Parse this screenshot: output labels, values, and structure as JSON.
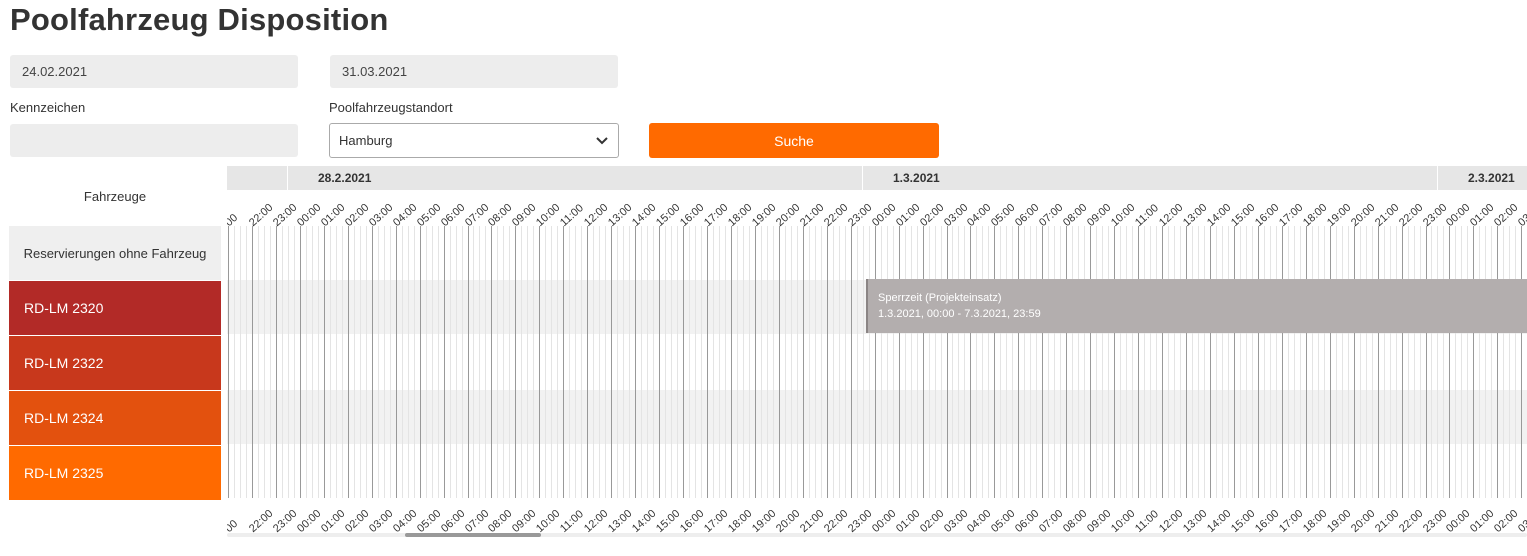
{
  "page": {
    "title": "Poolfahrzeug Disposition"
  },
  "filters": {
    "date_from": "24.02.2021",
    "date_to": "31.03.2021",
    "plate_label": "Kennzeichen",
    "plate_value": "",
    "location_label": "Poolfahrzeugstandort",
    "location_value": "Hamburg",
    "search_label": "Suche"
  },
  "scheduler": {
    "vehicles_header": "Fahrzeuge",
    "unassigned_label": "Reservierungen ohne Fahrzeug",
    "vehicles": [
      {
        "plate": "RD-LM 2320",
        "color": "#b22a27"
      },
      {
        "plate": "RD-LM 2322",
        "color": "#c8381c"
      },
      {
        "plate": "RD-LM 2324",
        "color": "#e3510e"
      },
      {
        "plate": "RD-LM 2325",
        "color": "#ff6a00"
      }
    ],
    "days": [
      "28.2.2021",
      "1.3.2021",
      "2.3.2021"
    ],
    "hours_visible": [
      "00",
      "22:00",
      "23:00",
      "00:00",
      "01:00",
      "02:00",
      "03:00",
      "04:00",
      "05:00",
      "06:00",
      "07:00",
      "08:00",
      "09:00",
      "10:00",
      "11:00",
      "12:00",
      "13:00",
      "14:00",
      "15:00",
      "16:00",
      "17:00",
      "18:00",
      "19:00",
      "20:00",
      "21:00",
      "22:00",
      "23:00",
      "00:00",
      "01:00",
      "02:00",
      "03:00",
      "04:00",
      "05:00",
      "06:00",
      "07:00",
      "08:00",
      "09:00",
      "10:00",
      "11:00",
      "12:00",
      "13:00",
      "14:00",
      "15:00",
      "16:00",
      "17:00",
      "18:00",
      "19:00",
      "20:00",
      "21:00",
      "22:00",
      "23:00",
      "00:00",
      "01:00",
      "02:00",
      "03:0"
    ],
    "reservation": {
      "title": "Sperrzeit (Projekteinsatz)",
      "period": "1.3.2021, 00:00 - 7.3.2021, 23:59",
      "vehicle": "RD-LM 2320"
    }
  },
  "colors": {
    "accent": "#ff6a00",
    "reservation": "#b3aeae",
    "row_stripe": "#f2f2f2"
  }
}
